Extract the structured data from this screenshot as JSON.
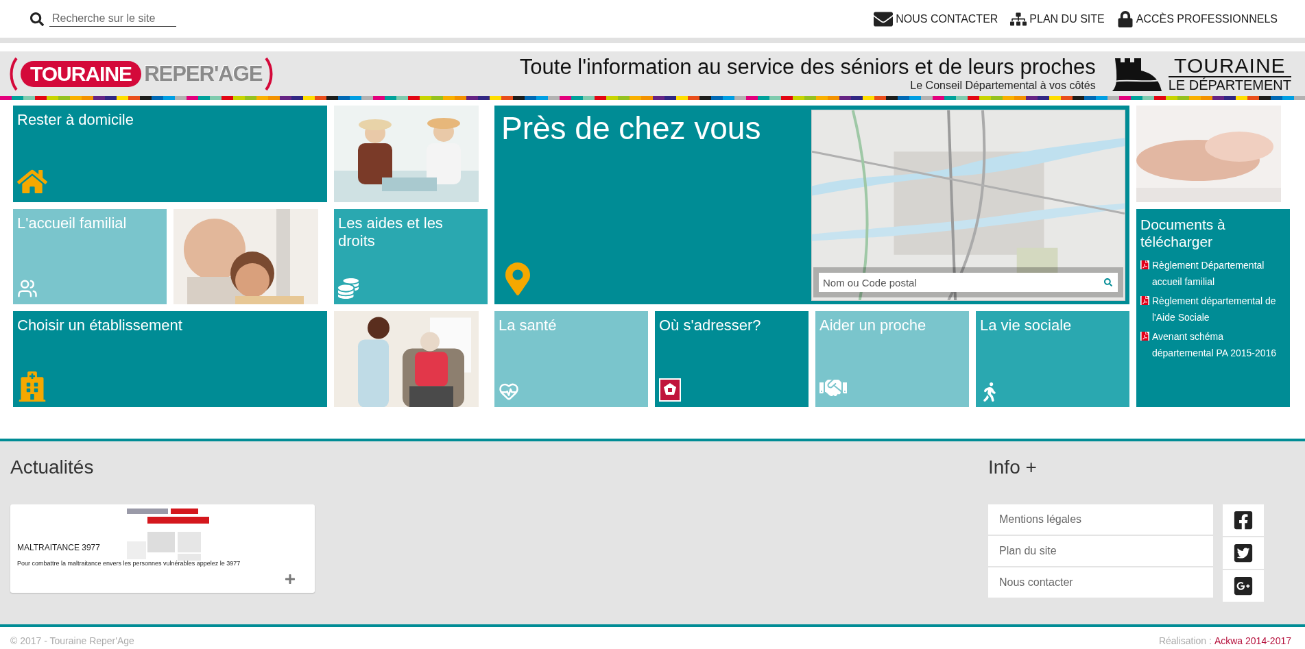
{
  "top_bar": {
    "search": {
      "placeholder": "Recherche sur le site"
    },
    "links": [
      {
        "label": "NOUS CONTACTER"
      },
      {
        "label": "PLAN DU SITE"
      },
      {
        "label": "ACCÈS PROFESSIONNELS"
      }
    ]
  },
  "banner": {
    "logo": {
      "part_1": "TOURAINE",
      "part_2": "REPER'AGE"
    },
    "tagline": "Toute l'information au service des séniors et de leurs proches",
    "subtitle": "Le Conseil Départemental à vos côtés",
    "department_logo": {
      "line_1": "TOURAINE",
      "line_2": "LE DÉPARTEMENT"
    }
  },
  "tiles": [
    {
      "kind": "tile",
      "title": "Rester à domicile",
      "color": "#008c95"
    },
    {
      "kind": "picture"
    },
    {
      "kind": "tile",
      "title": "L'accueil familial",
      "color": "#7ac5cc"
    },
    {
      "kind": "picture"
    },
    {
      "kind": "tile",
      "title": "Les aides et les droits",
      "color": "#2aa8b0"
    },
    {
      "kind": "tile",
      "title": "Choisir un établissement",
      "color": "#008c95"
    },
    {
      "kind": "picture"
    },
    {
      "kind": "map",
      "title": "Près de chez vous",
      "color": "#008c95",
      "search_placeholder": "Nom ou Code postal"
    },
    {
      "kind": "tile",
      "title": "La santé",
      "color": "#7ac5cc"
    },
    {
      "kind": "tile",
      "title": "Où s'adresser?",
      "color": "#008c95"
    },
    {
      "kind": "tile",
      "title": "Aider un proche",
      "color": "#7ac5cc"
    },
    {
      "kind": "tile",
      "title": "La vie sociale",
      "color": "#2aa8b0"
    },
    {
      "kind": "picture"
    },
    {
      "kind": "documents",
      "title": "Documents à télécharger",
      "color": "#008c95",
      "links": [
        "Règlement Départemental accueil familial",
        "Règlement départemental de l'Aide Sociale",
        "Avenant schéma départemental PA 2015-2016"
      ]
    }
  ],
  "news": {
    "heading": "Actualités",
    "items": [
      {
        "title": "MALTRAITANCE 3977",
        "text": "Pour combattre la maltraitance envers les personnes vulnérables appelez le 3977"
      }
    ]
  },
  "info": {
    "heading": "Info +",
    "links": [
      "Mentions légales",
      "Plan du site",
      "Nous contacter"
    ]
  },
  "footer": {
    "copyright": "© 2017 - Touraine Reper'Age",
    "credit_label": "Réalisation :",
    "credit_link": "Ackwa 2014-2017"
  }
}
